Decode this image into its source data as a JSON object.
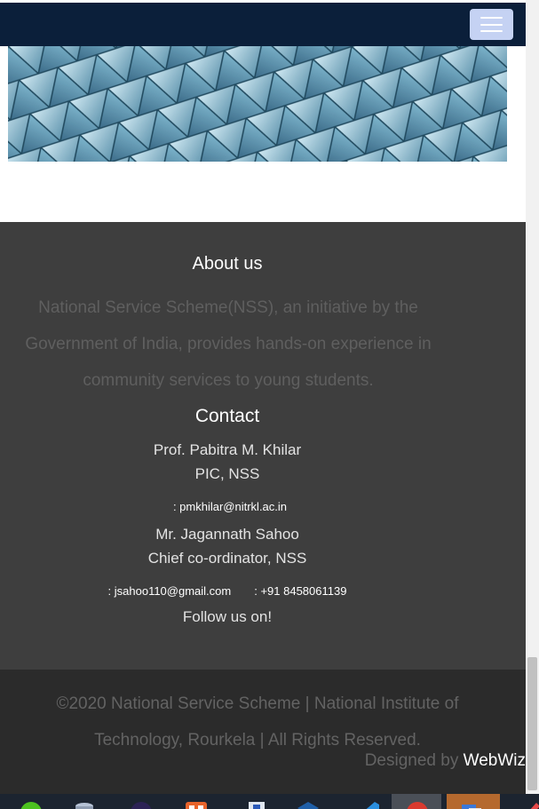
{
  "navbar": {
    "menu_icon": "hamburger-menu-icon"
  },
  "about": {
    "title": "About us",
    "text": "National Service Scheme(NSS), an initiative by the Government of India, provides hands-on experience in community services to young students."
  },
  "contact": {
    "title": "Contact",
    "person1": {
      "name": "Prof. Pabitra M. Khilar",
      "role": "PIC, NSS",
      "email": ": pmkhilar@nitrkl.ac.in"
    },
    "person2": {
      "name": "Mr. Jagannath Sahoo",
      "role": "Chief co-ordinator, NSS",
      "email": ": jsahoo110@gmail.com",
      "phone": ": +91 8458061139"
    }
  },
  "follow": {
    "title": "Follow us on!"
  },
  "footer": {
    "copyright": "©2020 National Service Scheme | National Institute of Technology, Rourkela | All Rights Reserved.",
    "designed_by_prefix": "Designed by ",
    "designed_by_brand": "WebWiz"
  },
  "colors": {
    "navbar_bg": "#0b1f3a",
    "footer_bg": "#3e3e3e",
    "footer_bottom_bg": "#2b2b2b",
    "toggle_bg": "#c5d2f3"
  },
  "taskbar": {
    "icons": [
      "green-app-icon",
      "database-icon",
      "eclipse-icon",
      "grid-app-icon",
      "document-icon",
      "virtualbox-icon",
      "vscode-icon",
      "chrome-icon",
      "file-manager-icon",
      "pencil-icon"
    ]
  }
}
